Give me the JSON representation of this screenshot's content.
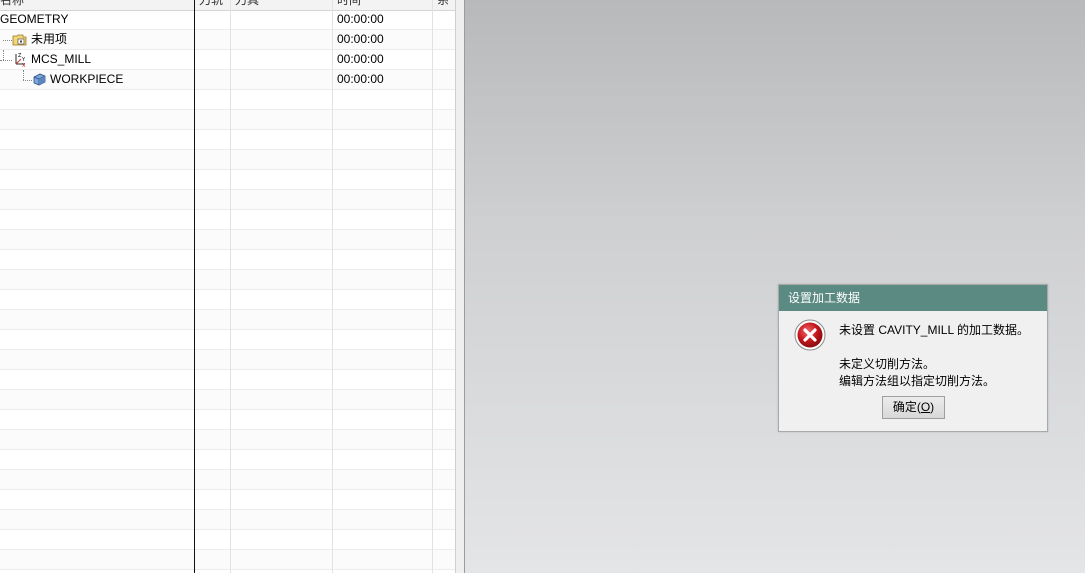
{
  "navigator": {
    "columns": [
      "名称",
      "刀轨",
      "刀具",
      "时间",
      "系"
    ],
    "rows": [
      {
        "name": "GEOMETRY",
        "time": "00:00:00"
      },
      {
        "name": "未用项",
        "time": "00:00:00"
      },
      {
        "name": "MCS_MILL",
        "time": "00:00:00"
      },
      {
        "name": "WORKPIECE",
        "time": "00:00:00"
      }
    ]
  },
  "dialog": {
    "title": "设置加工数据",
    "line1": "未设置 CAVITY_MILL 的加工数据。",
    "line2": "未定义切削方法。",
    "line3": "编辑方法组以指定切削方法。",
    "ok_prefix": "确定(",
    "ok_mnemonic": "O",
    "ok_suffix": ")"
  },
  "colors": {
    "dialog_title_bar": "#5b8a82",
    "error_red": "#c4161c"
  }
}
